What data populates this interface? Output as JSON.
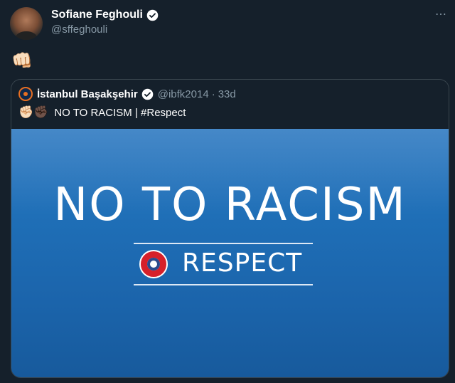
{
  "tweet": {
    "display_name": "Sofiane Feghouli",
    "handle": "@sffeghouli",
    "more_icon": "⋯",
    "body_emoji": "👊🏻"
  },
  "quoted": {
    "display_name": "İstanbul Başakşehir",
    "handle": "@ibfk2014",
    "separator": "·",
    "time": "33d",
    "emoji": "✊🏻✊🏿",
    "text": "NO TO RACISM | #Respect",
    "media": {
      "headline": "NO TO RACISM",
      "subline": "RESPECT"
    }
  },
  "colors": {
    "background": "#15202b",
    "secondary_text": "#8899a6",
    "border": "#38444d",
    "media_blue": "#1f6fb7"
  }
}
